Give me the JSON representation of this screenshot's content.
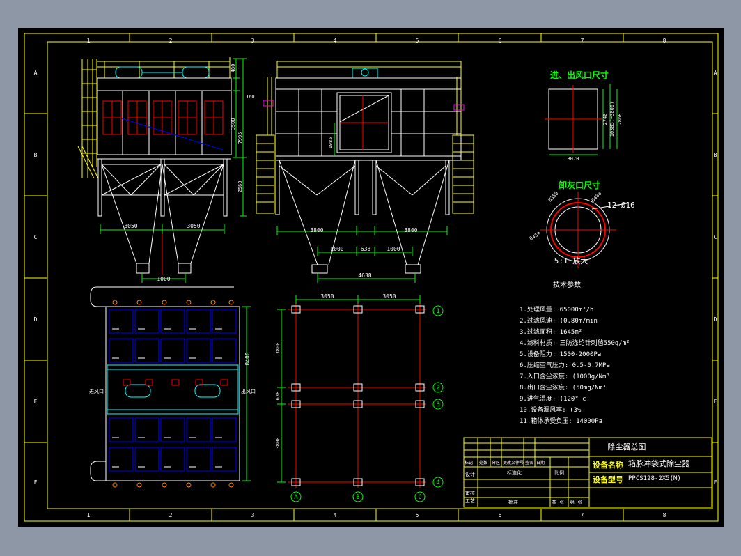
{
  "colors": {
    "background": "#000000",
    "frame": "#ffff00",
    "structure": "#ffffff",
    "dimension": "#00ff00",
    "section": "#ff0000",
    "filter": "#0000ff",
    "pipe": "#00ffff",
    "valve": "#ff00ff",
    "text": "#ffffff"
  },
  "grid_columns": [
    "1",
    "2",
    "3",
    "4",
    "5",
    "6",
    "7",
    "8"
  ],
  "grid_rows": [
    "A",
    "B",
    "C",
    "D",
    "E",
    "F"
  ],
  "dimensions": {
    "side_hopper_1": "3050",
    "side_hopper_2": "3050",
    "side_outlet": "1000",
    "side_h_1": "480",
    "side_h_2": "160",
    "side_h_3": "3500",
    "side_h_4": "7995",
    "side_h_5": "2560",
    "front_hopper_1": "3800",
    "front_hopper_2": "3800",
    "front_gap_1": "1000",
    "front_gap_2": "638",
    "front_gap_3": "1000",
    "front_total": "4638",
    "front_inlet_h": "1985",
    "plan_width": "8400",
    "support_top_1": "3050",
    "support_top_2": "3050",
    "support_v_1": "3800",
    "support_v_2": "638",
    "support_v_3": "3800",
    "duct_w": "3070",
    "duct_h_1": "2740",
    "duct_h_2": "10385(~3800)",
    "duct_h_3": "2868"
  },
  "labels": {
    "duct_title": "进、出风口尺寸",
    "flange_title": "卸灰口尺寸",
    "flange_bolts": "12-Ø16",
    "flange_scale": "5:1 放大",
    "flange_d1": "Ø350",
    "flange_d2": "Ø400",
    "flange_d3": "Ø450",
    "plan_inlet": "进风口",
    "plan_outlet": "出风口"
  },
  "axes": {
    "rows": [
      "1",
      "2",
      "3",
      "4"
    ],
    "cols": [
      "A",
      "B",
      "C"
    ]
  },
  "tech": {
    "title": "技术参数",
    "items": [
      "1.处理风量: 65000m³/h",
      "2.过滤风速: (0.80m/min",
      "3.过滤面积: 1645m²",
      "4.滤料材质: 三防涤纶针刺毡550g/m²",
      "5.设备阻力: 1500-2000Pa",
      "6.压缩空气压力: 0.5-0.7MPa",
      "7.入口含尘浓度: (1000g/Nm³",
      "8.出口含尘浓度: (50mg/Nm³",
      "9.进气温度: (120° c",
      "10.设备漏风率: (3%",
      "11.箱体承受负压: 14000Pa"
    ]
  },
  "title_block": {
    "drawing_name": "除尘器总图",
    "equipment_name_label": "设备名称",
    "equipment_name": "箱脉冲袋式除尘器",
    "equipment_model_label": "设备型号",
    "equipment_model": "PPCS128-2X5(M)",
    "rev_headers": [
      "标记",
      "处数",
      "分区",
      "更改文件号",
      "签名",
      "日期"
    ],
    "design": "设计",
    "standardize": "标准化",
    "scale": "比例",
    "review": "审核",
    "process": "工艺",
    "approve": "批准",
    "total": "共 张",
    "sheet": "第 张"
  }
}
